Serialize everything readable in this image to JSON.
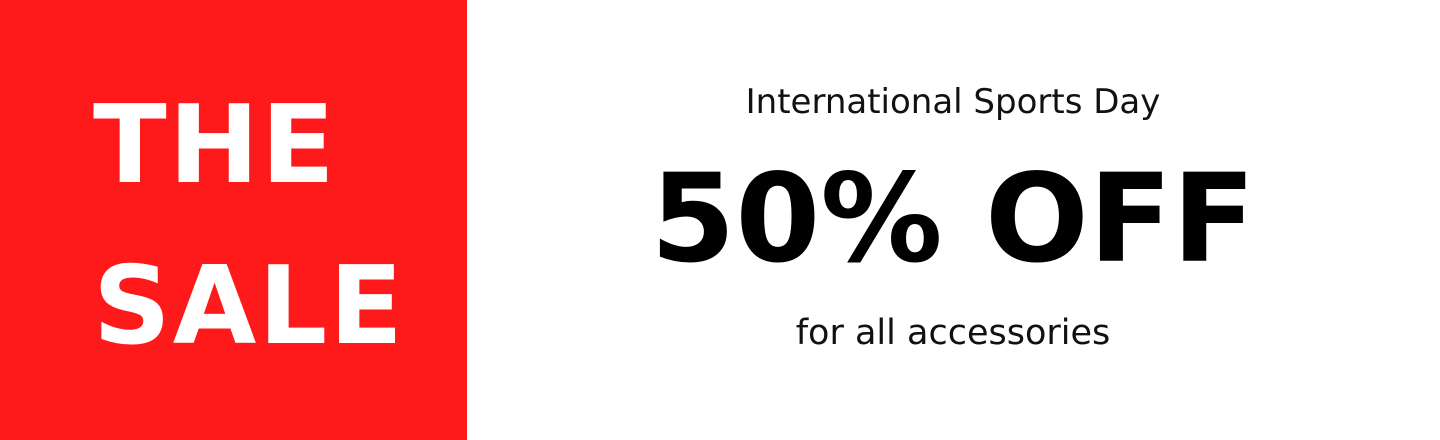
{
  "left_panel": {
    "line1": "THE",
    "line2": "SALE",
    "background_color": "#fe1a1a",
    "text_color": "#ffffff"
  },
  "right_panel": {
    "event_title": "International Sports Day",
    "discount": "50% OFF",
    "subtitle": "for all accessories",
    "text_color": "#000000"
  }
}
